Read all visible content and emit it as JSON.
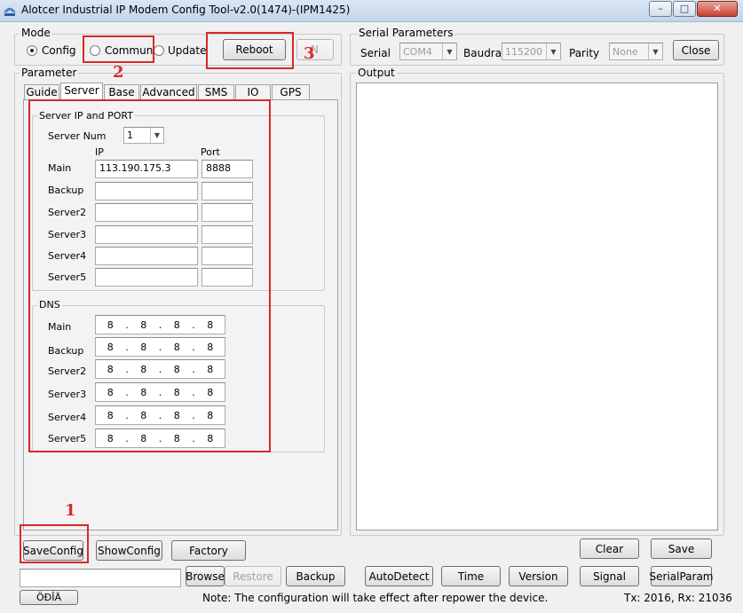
{
  "window": {
    "title": "Alotcer Industrial IP Modem Config Tool-v2.0(1474)-(IPM1425)",
    "minimize_glyph": "–",
    "maximize_glyph": "□",
    "close_glyph": "✕"
  },
  "mode": {
    "label": "Mode",
    "options": [
      "Config",
      "Commun",
      "Update"
    ],
    "selected": "Config",
    "reboot_label": "Reboot",
    "hidden_button_label": "N"
  },
  "serial": {
    "label": "Serial Parameters",
    "serial_label": "Serial",
    "serial_value": "COM4",
    "baud_label": "Baudrat",
    "baud_value": "115200",
    "parity_label": "Parity",
    "parity_value": "None",
    "close_label": "Close"
  },
  "parameter": {
    "label": "Parameter",
    "tabs": [
      "Guide",
      "Server",
      "Base",
      "Advanced",
      "SMS",
      "IO",
      "GPS"
    ],
    "active_tab": "Server"
  },
  "server_group": {
    "label": "Server IP and PORT",
    "server_num_label": "Server Num",
    "server_num_value": "1",
    "ip_header": "IP",
    "port_header": "Port",
    "rows": [
      {
        "label": "Main",
        "ip": "113.190.175.3",
        "port": "8888"
      },
      {
        "label": "Backup",
        "ip": "",
        "port": ""
      },
      {
        "label": "Server2",
        "ip": "",
        "port": ""
      },
      {
        "label": "Server3",
        "ip": "",
        "port": ""
      },
      {
        "label": "Server4",
        "ip": "",
        "port": ""
      },
      {
        "label": "Server5",
        "ip": "",
        "port": ""
      }
    ]
  },
  "dns_group": {
    "label": "DNS",
    "rows": [
      {
        "label": "Main",
        "octets": [
          "8",
          "8",
          "8",
          "8"
        ]
      },
      {
        "label": "Backup",
        "octets": [
          "8",
          "8",
          "8",
          "8"
        ]
      },
      {
        "label": "Server2",
        "octets": [
          "8",
          "8",
          "8",
          "8"
        ]
      },
      {
        "label": "Server3",
        "octets": [
          "8",
          "8",
          "8",
          "8"
        ]
      },
      {
        "label": "Server4",
        "octets": [
          "8",
          "8",
          "8",
          "8"
        ]
      },
      {
        "label": "Server5",
        "octets": [
          "8",
          "8",
          "8",
          "8"
        ]
      }
    ]
  },
  "output": {
    "label": "Output",
    "text": ""
  },
  "buttons": {
    "save_config": "SaveConfig",
    "show_config": "ShowConfig",
    "factory": "Factory",
    "clear": "Clear",
    "save": "Save",
    "browse": "Browse",
    "restore": "Restore",
    "backup": "Backup",
    "auto_detect": "AutoDetect",
    "time": "Time",
    "version": "Version",
    "signal": "Signal",
    "serial_param": "SerialParam",
    "lang": "ÖĐÎÄ"
  },
  "file_path": "",
  "status": {
    "note": "Note: The configuration will take effect after repower the device.",
    "txrx": "Tx: 2016, Rx: 21036"
  },
  "annotations": [
    "1",
    "2",
    "3"
  ],
  "colors": {
    "annotation_red": "#d42a2a"
  }
}
